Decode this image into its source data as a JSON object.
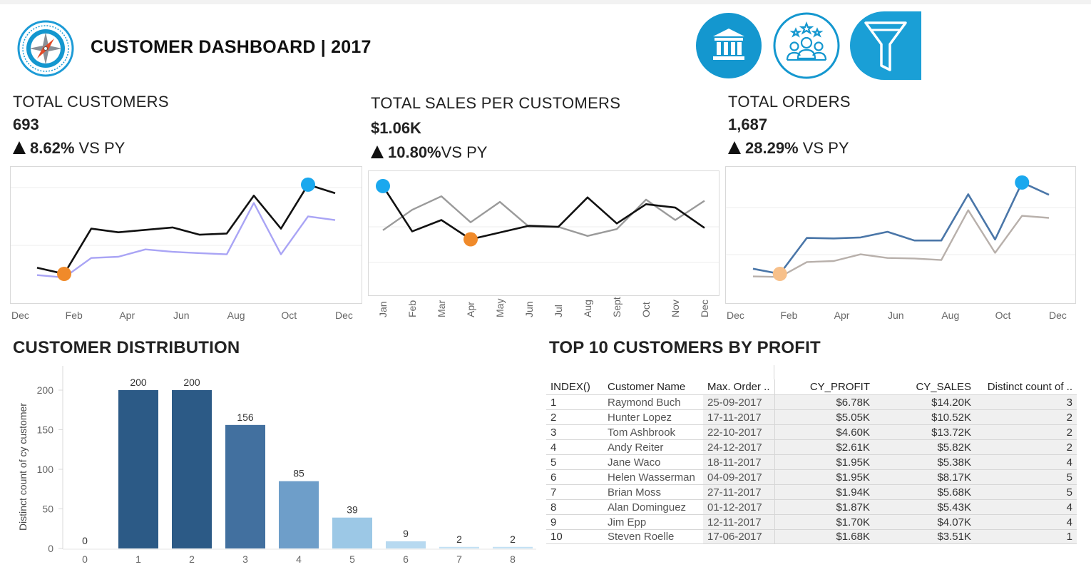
{
  "header": {
    "title": "CUSTOMER DASHBOARD | 2017",
    "buttons": [
      {
        "name": "bank-button",
        "icon": "bank-icon",
        "color": "#1497cf"
      },
      {
        "name": "customers-button",
        "icon": "people-stars-icon",
        "color": "#1497cf"
      },
      {
        "name": "filter-button",
        "icon": "filter-icon",
        "color": "#1a9fd6"
      }
    ]
  },
  "kpis": {
    "customers": {
      "title": "TOTAL CUSTOMERS",
      "value": "693",
      "delta": "8.62%",
      "suffix": " VS PY"
    },
    "sales": {
      "title": "TOTAL SALES PER CUSTOMERS",
      "value": "$1.06K",
      "delta": "10.80%",
      "suffix": "VS PY"
    },
    "orders": {
      "title": "TOTAL ORDERS",
      "value": "1,687",
      "delta": "28.29%",
      "suffix": " VS PY"
    }
  },
  "charts_axis": {
    "months_sparse": [
      "Dec",
      "Feb",
      "Apr",
      "Jun",
      "Aug",
      "Oct",
      "Dec"
    ],
    "months_full": [
      "Jan",
      "Feb",
      "Mar",
      "Apr",
      "May",
      "Jun",
      "Jul",
      "Aug",
      "Sept",
      "Oct",
      "Nov",
      "Dec"
    ]
  },
  "colors": {
    "cy_line": "#111111",
    "py_line_customers": "#a9a4f5",
    "py_line_sales": "#9a9a9a",
    "cy_line_orders": "#4a76a8",
    "py_line_orders": "#b8b0ab",
    "max_marker": "#1aa8ee",
    "min_marker": "#f08a2a",
    "min_marker_orders": "#f7c08a"
  },
  "distribution": {
    "title": "CUSTOMER DISTRIBUTION",
    "y_axis_label": "Distinct count of cy customer"
  },
  "top10": {
    "title": "TOP 10 CUSTOMERS BY PROFIT",
    "columns": [
      "INDEX()",
      "Customer Name",
      "Max. Order ..",
      "CY_PROFIT",
      "CY_SALES",
      "Distinct count of .."
    ],
    "rows": [
      [
        "1",
        "Raymond Buch",
        "25-09-2017",
        "$6.78K",
        "$14.20K",
        "3"
      ],
      [
        "2",
        "Hunter Lopez",
        "17-11-2017",
        "$5.05K",
        "$10.52K",
        "2"
      ],
      [
        "3",
        "Tom Ashbrook",
        "22-10-2017",
        "$4.60K",
        "$13.72K",
        "2"
      ],
      [
        "4",
        "Andy Reiter",
        "24-12-2017",
        "$2.61K",
        "$5.82K",
        "2"
      ],
      [
        "5",
        "Jane Waco",
        "18-11-2017",
        "$1.95K",
        "$5.38K",
        "4"
      ],
      [
        "6",
        "Helen Wasserman",
        "04-09-2017",
        "$1.95K",
        "$8.17K",
        "5"
      ],
      [
        "7",
        "Brian Moss",
        "27-11-2017",
        "$1.94K",
        "$5.68K",
        "5"
      ],
      [
        "8",
        "Alan Dominguez",
        "01-12-2017",
        "$1.87K",
        "$5.43K",
        "4"
      ],
      [
        "9",
        "Jim Epp",
        "12-11-2017",
        "$1.70K",
        "$4.07K",
        "4"
      ],
      [
        "10",
        "Steven Roelle",
        "17-06-2017",
        "$1.68K",
        "$3.51K",
        "1"
      ]
    ]
  },
  "chart_data": [
    {
      "type": "line",
      "x": [
        "Jan",
        "Feb",
        "Mar",
        "Apr",
        "May",
        "Jun",
        "Jul",
        "Aug",
        "Sep",
        "Oct",
        "Nov",
        "Dec"
      ],
      "x_tick_labels": [
        "Dec",
        "Feb",
        "Apr",
        "Jun",
        "Aug",
        "Oct",
        "Dec"
      ],
      "series": [
        {
          "values": [
            46,
            41,
            78,
            75,
            77,
            79,
            73,
            74,
            105,
            78,
            114,
            107
          ],
          "color": "#111111"
        },
        {
          "values": [
            40,
            38,
            54,
            55,
            61,
            59,
            58,
            57,
            99,
            57,
            88,
            85
          ],
          "color": "#a9a4f5"
        }
      ],
      "ylim": [
        20,
        125
      ],
      "markers": {
        "max": {
          "x": "Nov",
          "y": 114
        },
        "min": {
          "x": "Feb",
          "y": 41
        }
      }
    },
    {
      "type": "line",
      "x": [
        "Jan",
        "Feb",
        "Mar",
        "Apr",
        "May",
        "Jun",
        "Jul",
        "Aug",
        "Sept",
        "Oct",
        "Nov",
        "Dec"
      ],
      "series": [
        {
          "values": [
            1.35,
            0.95,
            1.05,
            0.88,
            0.94,
            1.0,
            0.99,
            1.25,
            1.02,
            1.19,
            1.16,
            0.98
          ],
          "color": "#111111"
        },
        {
          "values": [
            0.96,
            1.14,
            1.26,
            1.03,
            1.21,
            0.99,
            0.99,
            0.91,
            0.97,
            1.23,
            1.05,
            1.22
          ],
          "color": "#9a9a9a"
        }
      ],
      "ylim": [
        0.6,
        1.45
      ],
      "markers": {
        "max": {
          "x": "Jan",
          "y": 1.35
        },
        "min": {
          "x": "Apr",
          "y": 0.88
        }
      }
    },
    {
      "type": "line",
      "x": [
        "Jan",
        "Feb",
        "Mar",
        "Apr",
        "May",
        "Jun",
        "Jul",
        "Aug",
        "Sep",
        "Oct",
        "Nov",
        "Dec"
      ],
      "x_tick_labels": [
        "Dec",
        "Feb",
        "Apr",
        "Jun",
        "Aug",
        "Oct",
        "Dec"
      ],
      "series": [
        {
          "values": [
            100,
            90,
            160,
            159,
            161,
            172,
            155,
            155,
            245,
            157,
            268,
            244
          ],
          "color": "#4a76a8"
        },
        {
          "values": [
            85,
            84,
            113,
            115,
            128,
            121,
            120,
            117,
            214,
            131,
            203,
            199
          ],
          "color": "#b8b0ab"
        }
      ],
      "ylim": [
        40,
        290
      ],
      "markers": {
        "max": {
          "x": "Nov",
          "y": 268
        },
        "min": {
          "x": "Feb",
          "y": 90
        }
      }
    },
    {
      "type": "bar",
      "categories": [
        "0",
        "1",
        "2",
        "3",
        "4",
        "5",
        "6",
        "7",
        "8"
      ],
      "values": [
        0,
        200,
        200,
        156,
        85,
        39,
        9,
        2,
        2
      ],
      "ylabel": "Distinct count of cy customer",
      "ylim": [
        0,
        215
      ],
      "yticks": [
        0,
        50,
        100,
        150,
        200
      ],
      "bar_colors": [
        "#2c5a86",
        "#2c5a86",
        "#2c5a86",
        "#42709f",
        "#6e9ec9",
        "#9cc8e6",
        "#b7d9f0",
        "#c4e1f4",
        "#c4e1f4"
      ]
    }
  ]
}
